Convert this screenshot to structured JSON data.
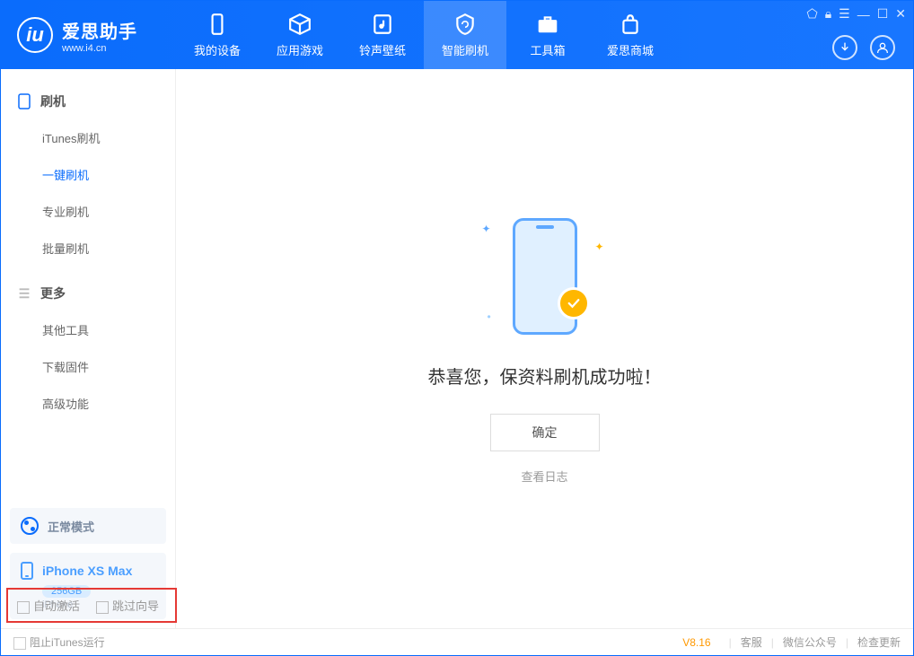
{
  "app": {
    "name": "爱思助手",
    "url": "www.i4.cn"
  },
  "tabs": [
    {
      "label": "我的设备"
    },
    {
      "label": "应用游戏"
    },
    {
      "label": "铃声壁纸"
    },
    {
      "label": "智能刷机"
    },
    {
      "label": "工具箱"
    },
    {
      "label": "爱思商城"
    }
  ],
  "sidebar": {
    "group1_title": "刷机",
    "group1_items": [
      "iTunes刷机",
      "一键刷机",
      "专业刷机",
      "批量刷机"
    ],
    "group2_title": "更多",
    "group2_items": [
      "其他工具",
      "下载固件",
      "高级功能"
    ]
  },
  "mode": {
    "label": "正常模式"
  },
  "device": {
    "name": "iPhone XS Max",
    "storage": "256GB",
    "type": "iPhone"
  },
  "options": {
    "auto_activate": "自动激活",
    "skip_guide": "跳过向导"
  },
  "main": {
    "success": "恭喜您，保资料刷机成功啦！",
    "ok": "确定",
    "view_log": "查看日志"
  },
  "status": {
    "block_itunes": "阻止iTunes运行",
    "version": "V8.16",
    "links": [
      "客服",
      "微信公众号",
      "检查更新"
    ]
  }
}
